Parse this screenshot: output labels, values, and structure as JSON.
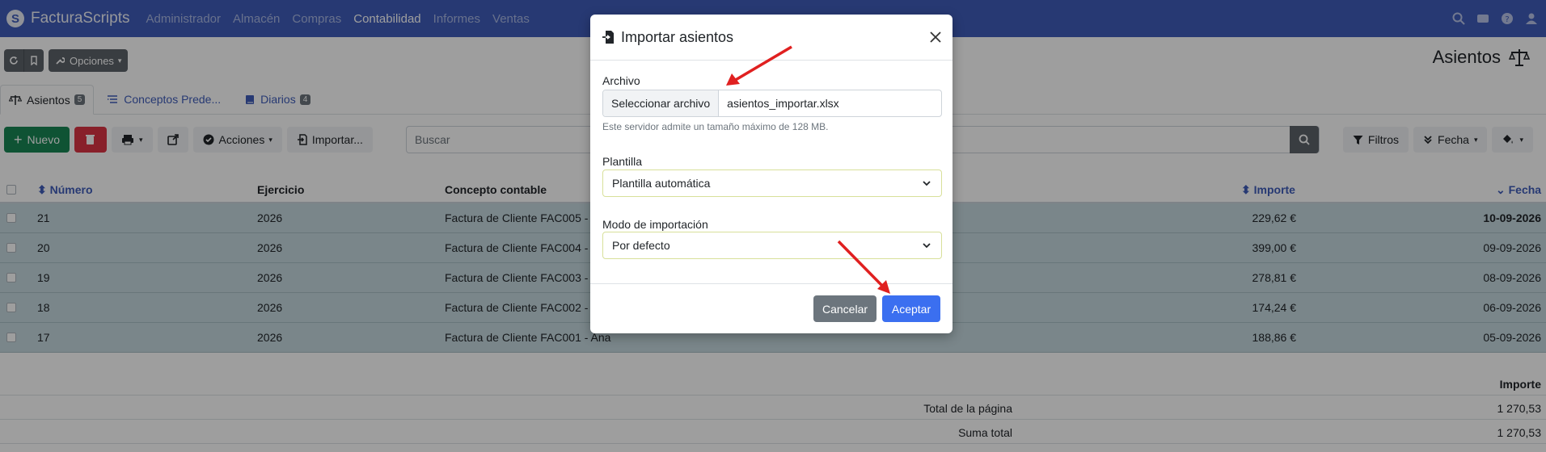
{
  "navbar": {
    "brand": "FacturaScripts",
    "menu": [
      "Administrador",
      "Almacén",
      "Compras",
      "Contabilidad",
      "Informes",
      "Ventas"
    ],
    "active_menu": "Contabilidad"
  },
  "toolbar": {
    "options_label": "Opciones"
  },
  "page": {
    "title": "Asientos"
  },
  "tabs": [
    {
      "label": "Asientos",
      "badge": "5"
    },
    {
      "label": "Conceptos Prede..."
    },
    {
      "label": "Diarios",
      "badge": "4"
    }
  ],
  "actions": {
    "new_label": "Nuevo",
    "actions_label": "Acciones",
    "import_label": "Importar...",
    "search_placeholder": "Buscar",
    "filters_label": "Filtros",
    "date_label": "Fecha"
  },
  "table": {
    "headers": {
      "number": "Número",
      "year": "Ejercicio",
      "concept": "Concepto contable",
      "amount": "Importe",
      "date": "Fecha"
    },
    "rows": [
      {
        "number": "21",
        "year": "2026",
        "concept": "Factura de Cliente FAC005 - ...",
        "amount": "229,62 €",
        "date": "10-09-2026"
      },
      {
        "number": "20",
        "year": "2026",
        "concept": "Factura de Cliente FAC004 - ...",
        "amount": "399,00 €",
        "date": "09-09-2026"
      },
      {
        "number": "19",
        "year": "2026",
        "concept": "Factura de Cliente FAC003 - ...",
        "amount": "278,81 €",
        "date": "08-09-2026"
      },
      {
        "number": "18",
        "year": "2026",
        "concept": "Factura de Cliente FAC002 - ...",
        "amount": "174,24 €",
        "date": "06-09-2026"
      },
      {
        "number": "17",
        "year": "2026",
        "concept": "Factura de Cliente FAC001 - Ana",
        "amount": "188,86 €",
        "date": "05-09-2026"
      }
    ]
  },
  "totals": {
    "header": "Importe",
    "page_total_label": "Total de la página",
    "page_total_value": "1 270,53",
    "sum_total_label": "Suma total",
    "sum_total_value": "1 270,53"
  },
  "modal": {
    "title": "Importar asientos",
    "file_label": "Archivo",
    "file_button": "Seleccionar archivo",
    "file_name": "asientos_importar.xlsx",
    "help": "Este servidor admite un tamaño máximo de 128 MB.",
    "template_label": "Plantilla",
    "template_value": "Plantilla automática",
    "mode_label": "Modo de importación",
    "mode_value": "Por defecto",
    "cancel": "Cancelar",
    "accept": "Aceptar"
  },
  "colors": {
    "navbar": "#3f5dba",
    "accent": "#3b6ff0",
    "success": "#198754",
    "danger": "#dc3545",
    "annotation": "#e02020"
  }
}
